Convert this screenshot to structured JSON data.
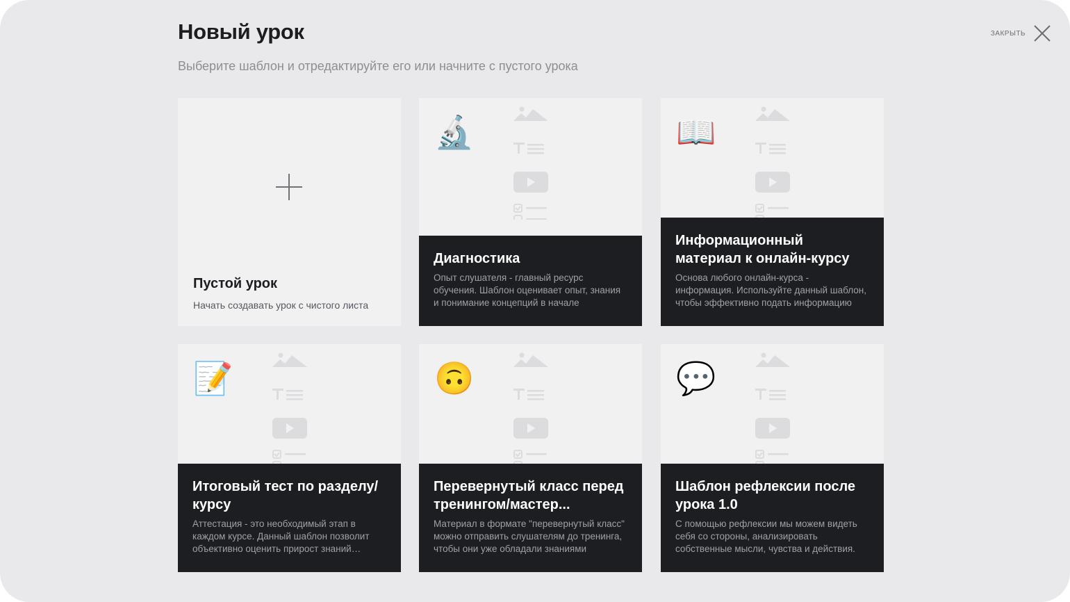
{
  "modal": {
    "title": "Новый урок",
    "subtitle": "Выберите шаблон и отредактируйте его или начните с пустого урока",
    "close_label": "ЗАКРЫТЬ"
  },
  "cards": [
    {
      "id": "empty",
      "title": "Пустой урок",
      "description": "Начать создавать урок с чистого листа",
      "icon": "plus-icon"
    },
    {
      "id": "diagnostics",
      "title": "Диагностика",
      "description": "Опыт слушателя - главный ресурс обучения. Шаблон оценивает опыт, знания и понимание концепций в начале",
      "emoji": "🔬",
      "icon": "microscope-icon"
    },
    {
      "id": "info-material",
      "title": "Информационный материал к онлайн-курсу",
      "description": "Основа любого онлайн-курса - информация. Используйте данный шаблон, чтобы эффективно подать информацию",
      "emoji": "📖",
      "icon": "open-book-icon"
    },
    {
      "id": "final-test",
      "title": "Итоговый тест по разделу/курсу",
      "description": "Аттестация - это необходимый этап в каждом курсе. Данный шаблон позволит объективно оценить прирост знаний слушателей",
      "emoji": "📝",
      "icon": "memo-icon"
    },
    {
      "id": "flipped-class",
      "title": "Перевернутый класс перед тренингом/мастер...",
      "description": "Материал в формате \"перевернутый класс\" можно отправить слушателям до тренинга, чтобы они уже обладали знаниями",
      "emoji": "🙃",
      "icon": "upside-down-face-icon"
    },
    {
      "id": "reflection",
      "title": "Шаблон рефлексии после урока 1.0",
      "description": "С помощью рефлексии мы можем видеть себя со стороны, анализировать собственные мысли, чувства и действия.",
      "emoji": "💬",
      "icon": "speech-balloon-icon"
    }
  ],
  "colors": {
    "modal_bg": "#e9e9eb",
    "card_bg": "#f1f1f2",
    "card_info_bg": "#1c1e22",
    "decor": "#dcdcde"
  }
}
